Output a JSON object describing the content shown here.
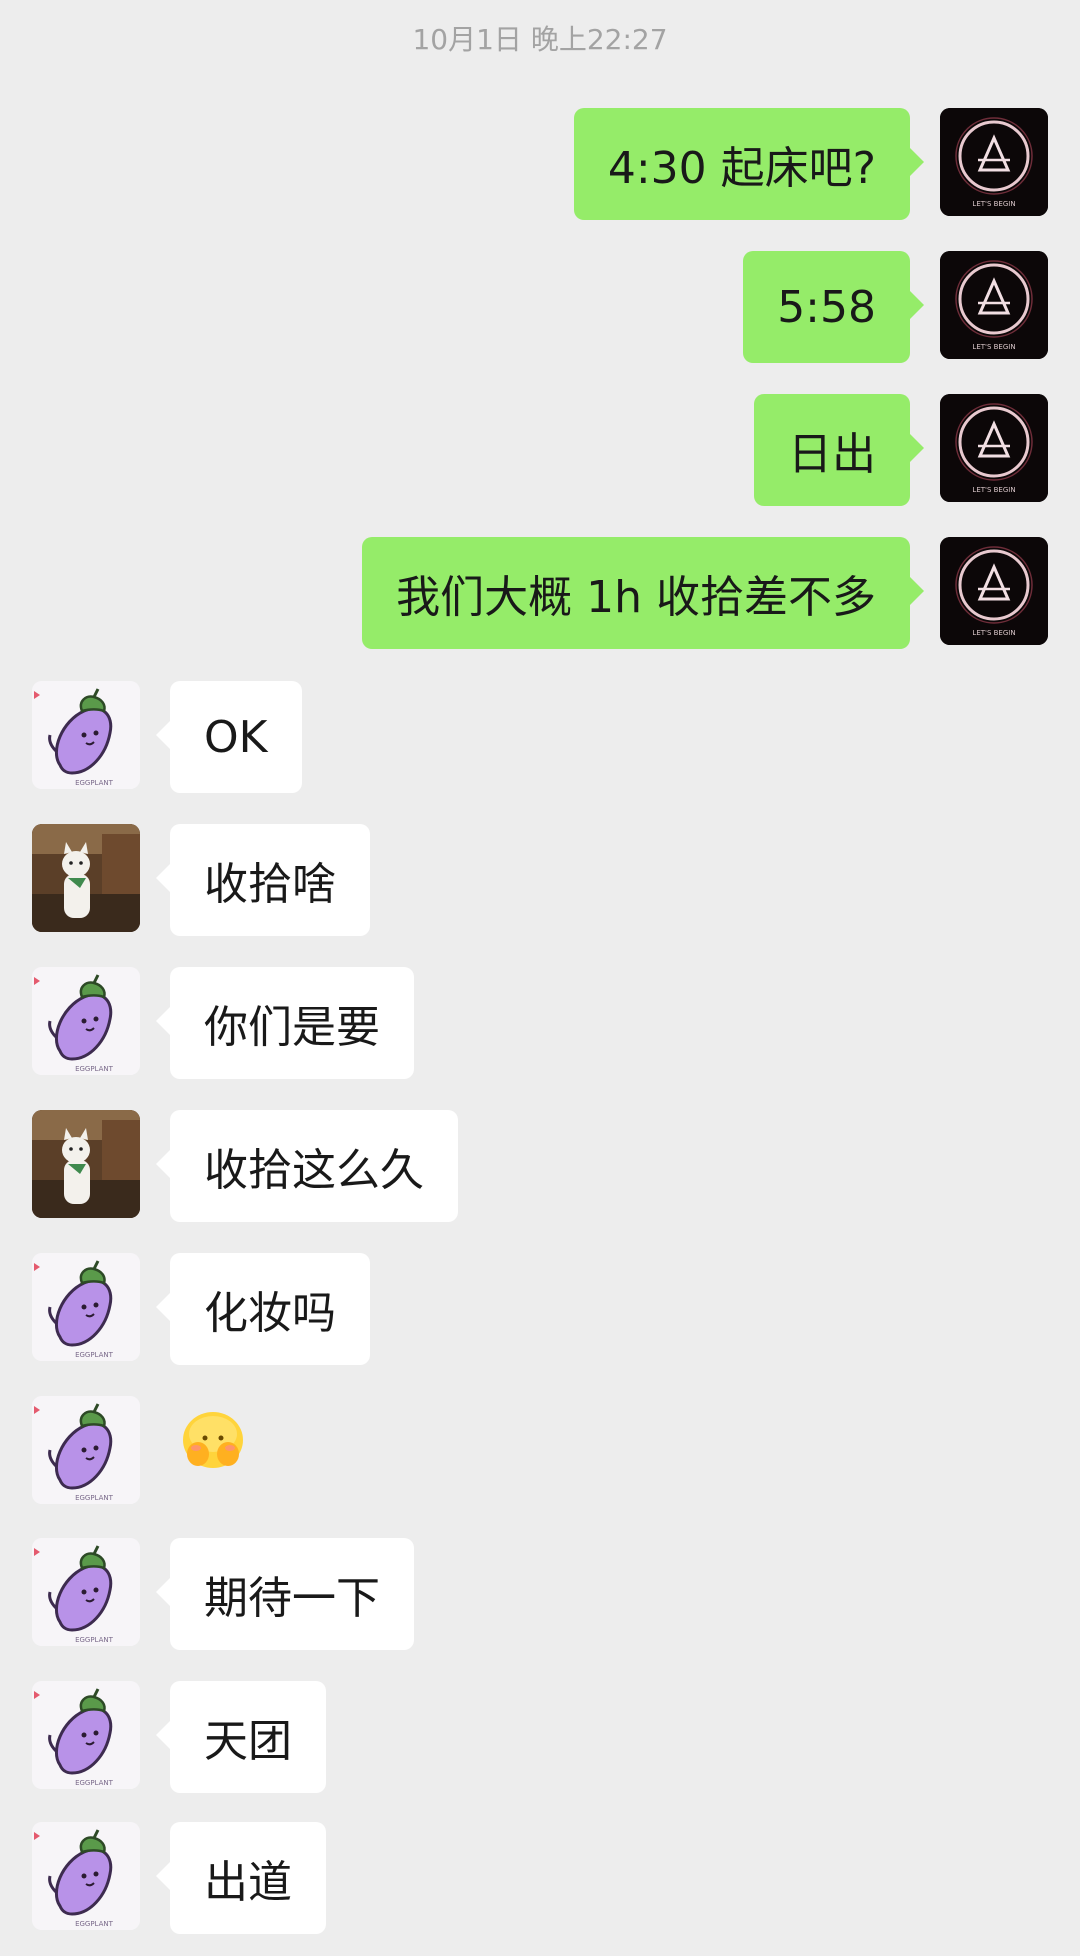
{
  "timestamp": "10月1日 晚上22:27",
  "colors": {
    "background": "#ededed",
    "sent_bubble": "#95ec69",
    "received_bubble": "#ffffff",
    "timestamp_text": "#a3a3a3"
  },
  "avatars": {
    "me": "linkin-park-logo-avatar",
    "friend_a": "eggplant-cartoon-avatar",
    "friend_b": "cat-photo-avatar"
  },
  "messages": [
    {
      "side": "sent",
      "sender": "me",
      "text": "4:30 起床吧?"
    },
    {
      "side": "sent",
      "sender": "me",
      "text": "5:58"
    },
    {
      "side": "sent",
      "sender": "me",
      "text": "日出"
    },
    {
      "side": "sent",
      "sender": "me",
      "text": "我们大概 1h 收拾差不多"
    },
    {
      "side": "received",
      "sender": "friend_a",
      "text": "OK"
    },
    {
      "side": "received",
      "sender": "friend_b",
      "text": "收拾啥"
    },
    {
      "side": "received",
      "sender": "friend_a",
      "text": "你们是要"
    },
    {
      "side": "received",
      "sender": "friend_b",
      "text": "收拾这么久"
    },
    {
      "side": "received",
      "sender": "friend_a",
      "text": "化妆吗"
    },
    {
      "side": "received",
      "sender": "friend_a",
      "emoji": "covering-face-emoji"
    },
    {
      "side": "received",
      "sender": "friend_a",
      "text": "期待一下"
    },
    {
      "side": "received",
      "sender": "friend_a",
      "text": "天团"
    },
    {
      "side": "received",
      "sender": "friend_a",
      "text": "出道"
    }
  ]
}
